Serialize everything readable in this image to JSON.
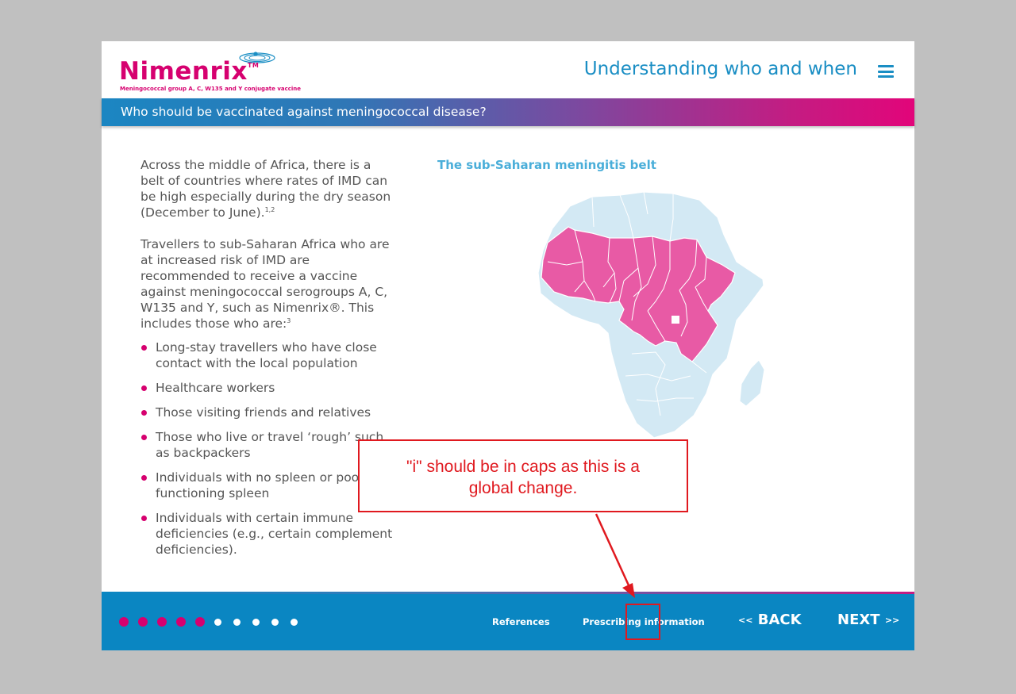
{
  "header": {
    "logo_word": "Nimenrix",
    "logo_tm": "TM",
    "logo_subtitle": "Meningococcal group A, C, W135 and Y conjugate vaccine",
    "section_title": "Understanding who and when",
    "menu_icon": "hamburger-menu-icon"
  },
  "title_band": {
    "text": "Who should be vaccinated against meningococcal disease?"
  },
  "content": {
    "para1": "Across the middle of Africa, there is a belt of countries where rates of IMD can be high especially during the dry season (December to June).",
    "para1_ref": "1,2",
    "para2": "Travellers to sub-Saharan Africa who are at increased risk of IMD are recommended to receive a vaccine against meningococcal serogroups A, C, W135 and Y, such as Nimenrix®. This includes those who are:",
    "para2_ref": "3",
    "bullets": [
      "Long-stay travellers who have close contact with the local population",
      "Healthcare workers",
      "Those visiting friends and relatives",
      "Those who live or travel ‘rough’ such as backpackers",
      "Individuals with no spleen or poorly functioning spleen",
      "Individuals with certain immune deficiencies (e.g., certain complement deficiencies)."
    ]
  },
  "map": {
    "title": "The sub-Saharan meningitis belt",
    "colors": {
      "belt": "#e85aa5",
      "land": "#d3e9f4",
      "border": "#ffffff"
    }
  },
  "annotation": {
    "line1": "\"i\" should be in caps as this is a",
    "line2": "global change.",
    "color": "#e0191f"
  },
  "footer": {
    "progress_total": 10,
    "progress_active": 5,
    "references_label": "References",
    "prescribing_label": "Prescribing information",
    "back_label": "BACK",
    "next_label": "NEXT",
    "back_prefix": "<<",
    "next_suffix": ">>"
  },
  "colors": {
    "brand_magenta": "#d6006f",
    "brand_blue": "#1a8ec4",
    "footer_blue": "#0a86c2"
  }
}
